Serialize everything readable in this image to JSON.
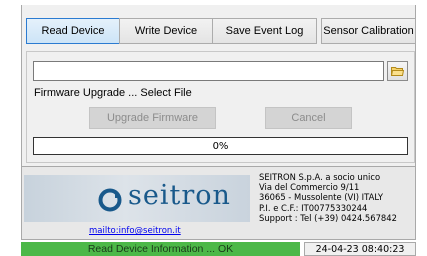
{
  "tabs": [
    {
      "label": "Read Device",
      "active": true
    },
    {
      "label": "Write Device",
      "active": false
    },
    {
      "label": "Save Event Log",
      "active": false
    },
    {
      "label": "Sensor Calibration",
      "active": false
    }
  ],
  "firmware": {
    "file_path": "",
    "select_label": "Firmware Upgrade ... Select File",
    "upgrade_label": "Upgrade Firmware",
    "cancel_label": "Cancel",
    "progress_percent": 0,
    "progress_text": "0%"
  },
  "info": {
    "logo_text": "seitron",
    "mail_link": "mailto:info@seitron.it",
    "company_lines": [
      "SEITRON S.p.A. a socio unico",
      "Via del Commercio 9/11",
      "36065 - Mussolente (VI) ITALY",
      "P.I. e C.F.: IT00775330244",
      "Support : Tel (+39) 0424.567842"
    ]
  },
  "status": {
    "message": "Read Device Information ... OK",
    "timestamp": "24-04-23 08:40:23",
    "color": "#4cb848"
  },
  "icons": {
    "browse": "folder-icon",
    "logo": "seitron-logo-mark"
  }
}
